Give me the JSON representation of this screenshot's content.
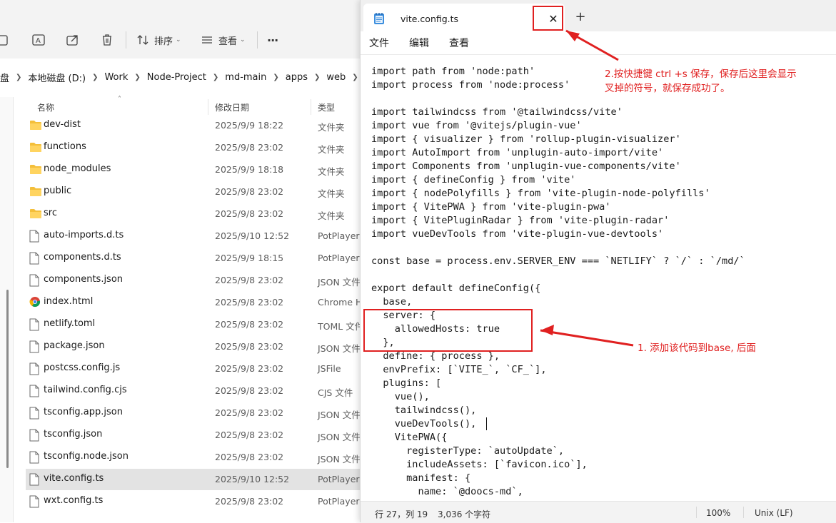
{
  "explorer": {
    "toolbar": {
      "sort_label": "排序",
      "view_label": "查看",
      "more_label": "···"
    },
    "breadcrumb": {
      "truncated_label": "盘",
      "items": [
        "本地磁盘 (D:)",
        "Work",
        "Node-Project",
        "md-main",
        "apps",
        "web"
      ]
    },
    "columns": {
      "name": "名称",
      "date": "修改日期",
      "type": "类型"
    },
    "files": [
      {
        "name": "dev-dist",
        "date": "2025/9/9 18:22",
        "type": "文件夹",
        "kind": "folder"
      },
      {
        "name": "functions",
        "date": "2025/9/8 23:02",
        "type": "文件夹",
        "kind": "folder"
      },
      {
        "name": "node_modules",
        "date": "2025/9/9 18:18",
        "type": "文件夹",
        "kind": "folder"
      },
      {
        "name": "public",
        "date": "2025/9/8 23:02",
        "type": "文件夹",
        "kind": "folder"
      },
      {
        "name": "src",
        "date": "2025/9/8 23:02",
        "type": "文件夹",
        "kind": "folder"
      },
      {
        "name": "auto-imports.d.ts",
        "date": "2025/9/10 12:52",
        "type": "PotPlayerM",
        "kind": "file"
      },
      {
        "name": "components.d.ts",
        "date": "2025/9/9 18:15",
        "type": "PotPlayerM",
        "kind": "file"
      },
      {
        "name": "components.json",
        "date": "2025/9/8 23:02",
        "type": "JSON 文件",
        "kind": "file"
      },
      {
        "name": "index.html",
        "date": "2025/9/8 23:02",
        "type": "Chrome H",
        "kind": "chrome"
      },
      {
        "name": "netlify.toml",
        "date": "2025/9/8 23:02",
        "type": "TOML 文件",
        "kind": "file"
      },
      {
        "name": "package.json",
        "date": "2025/9/8 23:02",
        "type": "JSON 文件",
        "kind": "file"
      },
      {
        "name": "postcss.config.js",
        "date": "2025/9/8 23:02",
        "type": "JSFile",
        "kind": "file"
      },
      {
        "name": "tailwind.config.cjs",
        "date": "2025/9/8 23:02",
        "type": "CJS 文件",
        "kind": "file"
      },
      {
        "name": "tsconfig.app.json",
        "date": "2025/9/8 23:02",
        "type": "JSON 文件",
        "kind": "file"
      },
      {
        "name": "tsconfig.json",
        "date": "2025/9/8 23:02",
        "type": "JSON 文件",
        "kind": "file"
      },
      {
        "name": "tsconfig.node.json",
        "date": "2025/9/8 23:02",
        "type": "JSON 文件",
        "kind": "file"
      },
      {
        "name": "vite.config.ts",
        "date": "2025/9/10 12:52",
        "type": "PotPlayerM",
        "kind": "file",
        "selected": true
      },
      {
        "name": "wxt.config.ts",
        "date": "2025/9/8 23:02",
        "type": "PotPlayerM",
        "kind": "file"
      }
    ]
  },
  "notepad": {
    "tab_title": "vite.config.ts",
    "close_glyph": "✕",
    "newtab_glyph": "+",
    "menu": {
      "file": "文件",
      "edit": "编辑",
      "view": "查看"
    },
    "code_lines": [
      "import path from 'node:path'",
      "import process from 'node:process'",
      "",
      "import tailwindcss from '@tailwindcss/vite'",
      "import vue from '@vitejs/plugin-vue'",
      "import { visualizer } from 'rollup-plugin-visualizer'",
      "import AutoImport from 'unplugin-auto-import/vite'",
      "import Components from 'unplugin-vue-components/vite'",
      "import { defineConfig } from 'vite'",
      "import { nodePolyfills } from 'vite-plugin-node-polyfills'",
      "import { VitePWA } from 'vite-plugin-pwa'",
      "import { VitePluginRadar } from 'vite-plugin-radar'",
      "import vueDevTools from 'vite-plugin-vue-devtools'",
      "",
      "const base = process.env.SERVER_ENV === `NETLIFY` ? `/` : `/md/`",
      "",
      "export default defineConfig({",
      "  base,",
      "  server: {",
      "    allowedHosts: true",
      "  },",
      "  define: { process },",
      "  envPrefix: [`VITE_`, `CF_`],",
      "  plugins: [",
      "    vue(),",
      "    tailwindcss(),",
      "    vueDevTools(),",
      "    VitePWA({",
      "      registerType: `autoUpdate`,",
      "      includeAssets: [`favicon.ico`],",
      "      manifest: {",
      "        name: `@doocs-md`,"
    ],
    "status": {
      "position": "行 27，列 19",
      "chars": "3,036 个字符",
      "zoom": "100%",
      "line_ending": "Unix (LF)"
    }
  },
  "annotations": {
    "note_top_line1": "2.按快捷键 ctrl +s 保存，保存后这里会显示",
    "note_top_line2": "叉掉的符号，就保存成功了。",
    "note_middle": "1. 添加该代码到base, 后面",
    "color": "#e02020"
  }
}
